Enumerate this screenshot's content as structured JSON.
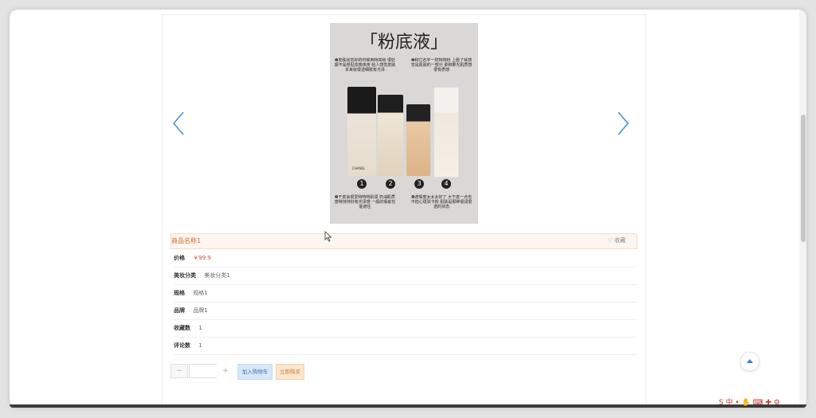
{
  "carousel": {
    "prev_icon": "chevron-left-icon",
    "next_icon": "chevron-right-icon",
    "image": {
      "title": "「粉底液」",
      "note_1": "❶皮肤状态好的时候用特高级 很妊娠不是很贴妆像夜夜 给人感觉皮肤本来就很透细腻有光泽",
      "note_2": "❷和它名字一样特持粉 上脸了就感觉是肌肤的一部分 柔和雾光肌质感很有质感",
      "note_3": "❸干皮会很爱特特特别润 奶油肌质感特持持好有光泽感 一般的瑕疵也能遮住",
      "note_4": "❹遮瑕度太太太好了 大干皮一点也不担心斑驳卡粉 肌肤是那种很润很透的状态",
      "num_1": "1",
      "num_2": "2",
      "num_3": "3",
      "num_4": "4",
      "brand_1": "CHANEL"
    }
  },
  "product": {
    "name": "商品名称1",
    "favorite_label": "♡ 收藏",
    "attributes": [
      {
        "label": "价格",
        "value": "￥99.9"
      },
      {
        "label": "美妆分类",
        "value": "美妆分类1"
      },
      {
        "label": "规格",
        "value": "规格1"
      },
      {
        "label": "品牌",
        "value": "品牌1"
      },
      {
        "label": "收藏数",
        "value": "1"
      },
      {
        "label": "评论数",
        "value": "1"
      }
    ]
  },
  "purchase": {
    "minus_label": "−",
    "quantity_value": "",
    "plus_label": "+",
    "add_to_cart_label": "加入购物车",
    "buy_now_label": "立即购买"
  },
  "floating": {
    "back_to_top_icon": "caret-up-icon",
    "ime_tray_text": "S 中 • ✋ ⌨ ✚ ⚙"
  },
  "colors": {
    "accent_orange": "#d56a2c",
    "price_red": "#d34a3a",
    "cart_blue": "#3b73b8",
    "arrow_blue": "#4a90d9"
  }
}
